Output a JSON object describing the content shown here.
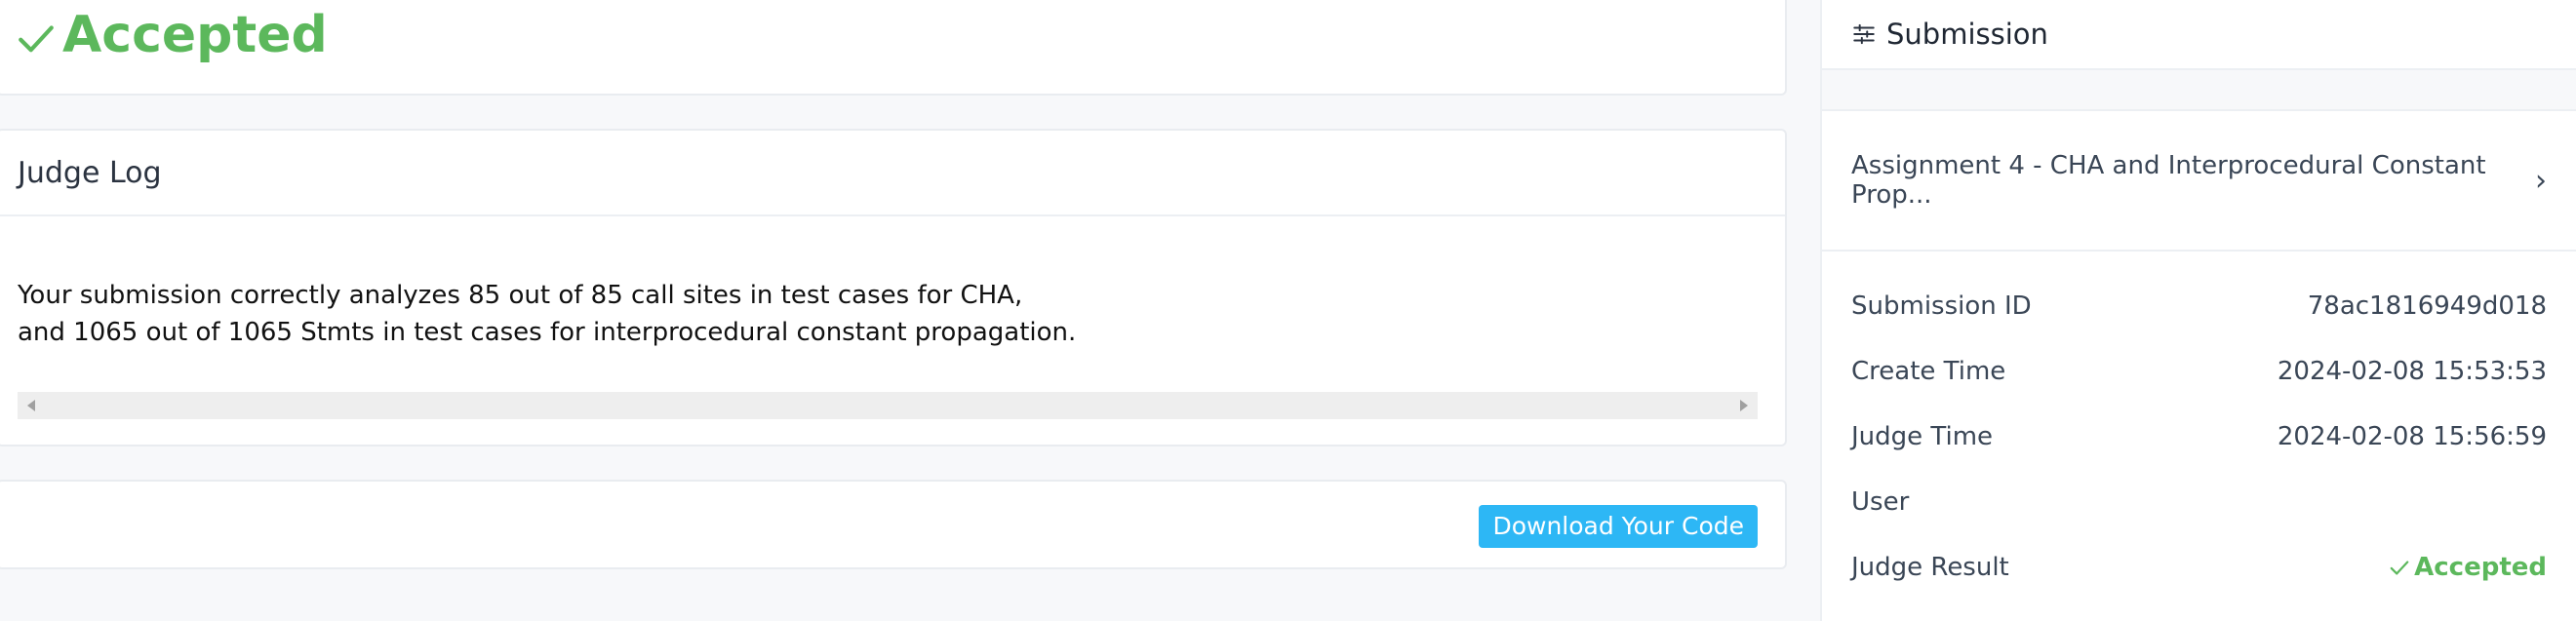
{
  "result": {
    "title": "Accepted",
    "icon": "check-icon",
    "color": "#5cb85c"
  },
  "judge_log": {
    "title": "Judge Log",
    "lines": [
      "Your submission correctly analyzes 85 out of 85 call sites in test cases for CHA,",
      "and 1065 out of 1065 Stmts in test cases for interprocedural constant propagation."
    ]
  },
  "actions": {
    "download_label": "Download Your Code",
    "download_color": "#2db7f5"
  },
  "sidebar": {
    "title": "Submission",
    "icon": "sliders-icon",
    "assignment": "Assignment 4 - CHA and Interprocedural Constant Prop...",
    "details": [
      {
        "label": "Submission ID",
        "value": "78ac1816949d018"
      },
      {
        "label": "Create Time",
        "value": "2024-02-08 15:53:53"
      },
      {
        "label": "Judge Time",
        "value": "2024-02-08 15:56:59"
      },
      {
        "label": "User",
        "value": ""
      },
      {
        "label": "Judge Result",
        "value": "Accepted"
      }
    ]
  }
}
